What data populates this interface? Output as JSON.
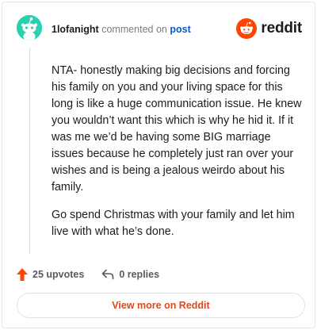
{
  "comment": {
    "username": "1lofanight",
    "commented_on": "commented on",
    "post_link": "post",
    "paragraphs": [
      "NTA- honestly making big decisions and forcing his family on you and your living space for this long is like a huge communication issue. He knew you wouldn’t want this which is why he hid it. If it was me we’d be having some BIG marriage issues because he completely just ran over your wishes and is being a jealous weirdo about his family.",
      "Go spend Christmas with your family and let him live with what he’s done."
    ]
  },
  "brand": {
    "name": "reddit",
    "color": "#ff4500"
  },
  "actions": {
    "upvotes": "25 upvotes",
    "replies": "0 replies"
  },
  "view_more": {
    "label": "View more on Reddit"
  },
  "colors": {
    "avatar_bg": "#2ad1b0",
    "upvote": "#ff4500",
    "link": "#0a58ca",
    "view_more": "#d94a1e"
  },
  "icons": [
    "snoo-avatar-icon",
    "reddit-logo-icon",
    "upvote-arrow-icon",
    "reply-arrow-icon"
  ]
}
